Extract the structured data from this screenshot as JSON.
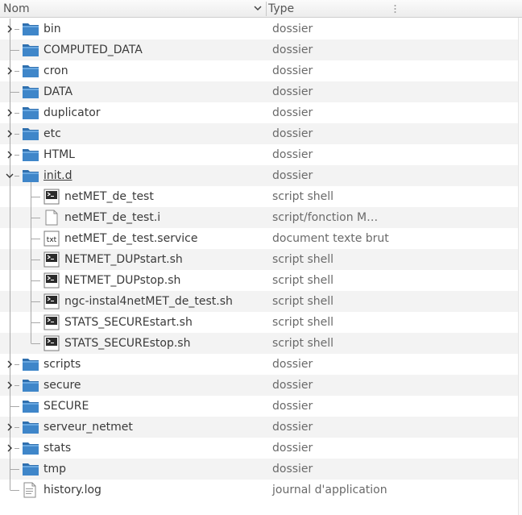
{
  "header": {
    "name_label": "Nom",
    "type_label": "Type"
  },
  "rows": [
    {
      "name": "bin",
      "type": "dossier",
      "kind": "folder",
      "depth": 0,
      "expander": "collapsed"
    },
    {
      "name": "COMPUTED_DATA",
      "type": "dossier",
      "kind": "folder",
      "depth": 0,
      "expander": "none"
    },
    {
      "name": "cron",
      "type": "dossier",
      "kind": "folder",
      "depth": 0,
      "expander": "collapsed"
    },
    {
      "name": "DATA",
      "type": "dossier",
      "kind": "folder",
      "depth": 0,
      "expander": "none"
    },
    {
      "name": "duplicator",
      "type": "dossier",
      "kind": "folder",
      "depth": 0,
      "expander": "collapsed"
    },
    {
      "name": "etc",
      "type": "dossier",
      "kind": "folder",
      "depth": 0,
      "expander": "collapsed"
    },
    {
      "name": "HTML",
      "type": "dossier",
      "kind": "folder",
      "depth": 0,
      "expander": "collapsed"
    },
    {
      "name": "init.d",
      "type": "dossier",
      "kind": "folder",
      "depth": 0,
      "expander": "expanded",
      "underline": true
    },
    {
      "name": "netMET_de_test",
      "type": "script shell",
      "kind": "shell",
      "depth": 1
    },
    {
      "name": "netMET_de_test.i",
      "type": "script/fonction M…",
      "kind": "blank",
      "depth": 1
    },
    {
      "name": "netMET_de_test.service",
      "type": "document texte brut",
      "kind": "txt",
      "depth": 1
    },
    {
      "name": "NETMET_DUPstart.sh",
      "type": "script shell",
      "kind": "shell",
      "depth": 1
    },
    {
      "name": "NETMET_DUPstop.sh",
      "type": "script shell",
      "kind": "shell",
      "depth": 1
    },
    {
      "name": "ngc-instal4netMET_de_test.sh",
      "type": "script shell",
      "kind": "shell",
      "depth": 1
    },
    {
      "name": "STATS_SECUREstart.sh",
      "type": "script shell",
      "kind": "shell",
      "depth": 1
    },
    {
      "name": "STATS_SECUREstop.sh",
      "type": "script shell",
      "kind": "shell",
      "depth": 1,
      "last": true
    },
    {
      "name": "scripts",
      "type": "dossier",
      "kind": "folder",
      "depth": 0,
      "expander": "collapsed"
    },
    {
      "name": "secure",
      "type": "dossier",
      "kind": "folder",
      "depth": 0,
      "expander": "collapsed"
    },
    {
      "name": "SECURE",
      "type": "dossier",
      "kind": "folder",
      "depth": 0,
      "expander": "none"
    },
    {
      "name": "serveur_netmet",
      "type": "dossier",
      "kind": "folder",
      "depth": 0,
      "expander": "collapsed"
    },
    {
      "name": "stats",
      "type": "dossier",
      "kind": "folder",
      "depth": 0,
      "expander": "collapsed"
    },
    {
      "name": "tmp",
      "type": "dossier",
      "kind": "folder",
      "depth": 0,
      "expander": "none"
    },
    {
      "name": "history.log",
      "type": "journal d'application",
      "kind": "log",
      "depth": 0,
      "expander": "none",
      "last": true
    }
  ],
  "icons": {
    "txt_badge": "txt"
  },
  "colors": {
    "folder_blue": "#3f86c9",
    "alt_row": "#f3f3f3",
    "tree_line": "#a8a8a8"
  }
}
